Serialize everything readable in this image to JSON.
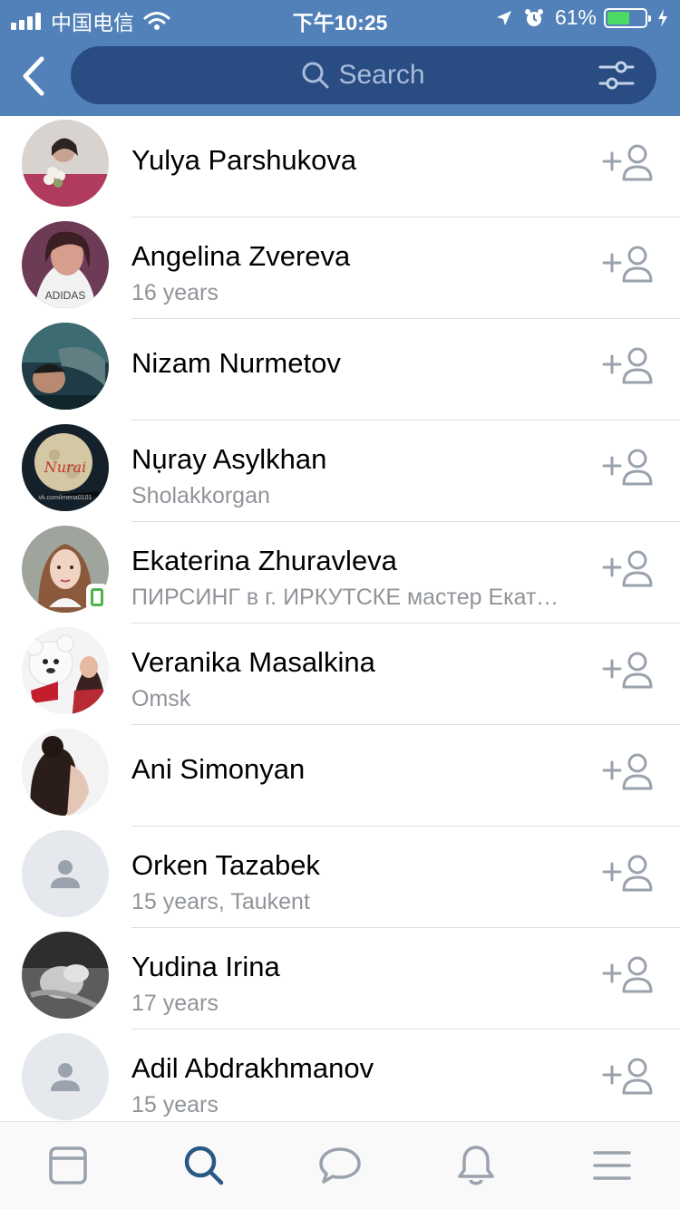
{
  "status_bar": {
    "carrier": "中国电信",
    "time": "下午10:25",
    "battery_percent": "61%",
    "battery_level": 0.61
  },
  "header": {
    "back_icon": "chevron-left-icon",
    "search": {
      "placeholder": "Search",
      "icon": "search-icon"
    },
    "filter_icon": "sliders-icon"
  },
  "results": [
    {
      "name": "Yulya Parshukova",
      "subtitle": "",
      "avatar": "photo"
    },
    {
      "name": "Angelina Zvereva",
      "subtitle": "16 years",
      "avatar": "photo"
    },
    {
      "name": "Nizam Nurmetov",
      "subtitle": "",
      "avatar": "photo"
    },
    {
      "name": "Nụray Asylkhan",
      "subtitle": "Sholakkorgan",
      "avatar": "photo",
      "avatar_text": "Nurai",
      "avatar_caption": "vk.com/imena0101"
    },
    {
      "name": "Ekaterina Zhuravleva",
      "subtitle": "ПИРСИНГ в г. ИРКУТСКЕ мастер Екатерина",
      "avatar": "photo",
      "online_mobile": true
    },
    {
      "name": "Veranika Masalkina",
      "subtitle": "Omsk",
      "avatar": "photo"
    },
    {
      "name": "Ani Simonyan",
      "subtitle": "",
      "avatar": "photo"
    },
    {
      "name": "Orken Tazabek",
      "subtitle": "15 years, Taukent",
      "avatar": "default"
    },
    {
      "name": "Yudina Irina",
      "subtitle": "17 years",
      "avatar": "photo"
    },
    {
      "name": "Adil Abdrakhmanov",
      "subtitle": "15 years",
      "avatar": "default"
    }
  ],
  "row_action_icon": "add-friend-icon",
  "tab_bar": [
    {
      "id": "news",
      "icon": "newsfeed-icon",
      "active": false
    },
    {
      "id": "search",
      "icon": "search-icon",
      "active": true
    },
    {
      "id": "messages",
      "icon": "chat-bubble-icon",
      "active": false
    },
    {
      "id": "notifications",
      "icon": "bell-icon",
      "active": false
    },
    {
      "id": "menu",
      "icon": "hamburger-menu-icon",
      "active": false
    }
  ],
  "colors": {
    "header": "#5181b8",
    "search_field": "#294c82",
    "accent": "#2a5885",
    "inactive_icon": "#99a2ad",
    "online": "#4bb34b",
    "battery": "#4cd964"
  }
}
